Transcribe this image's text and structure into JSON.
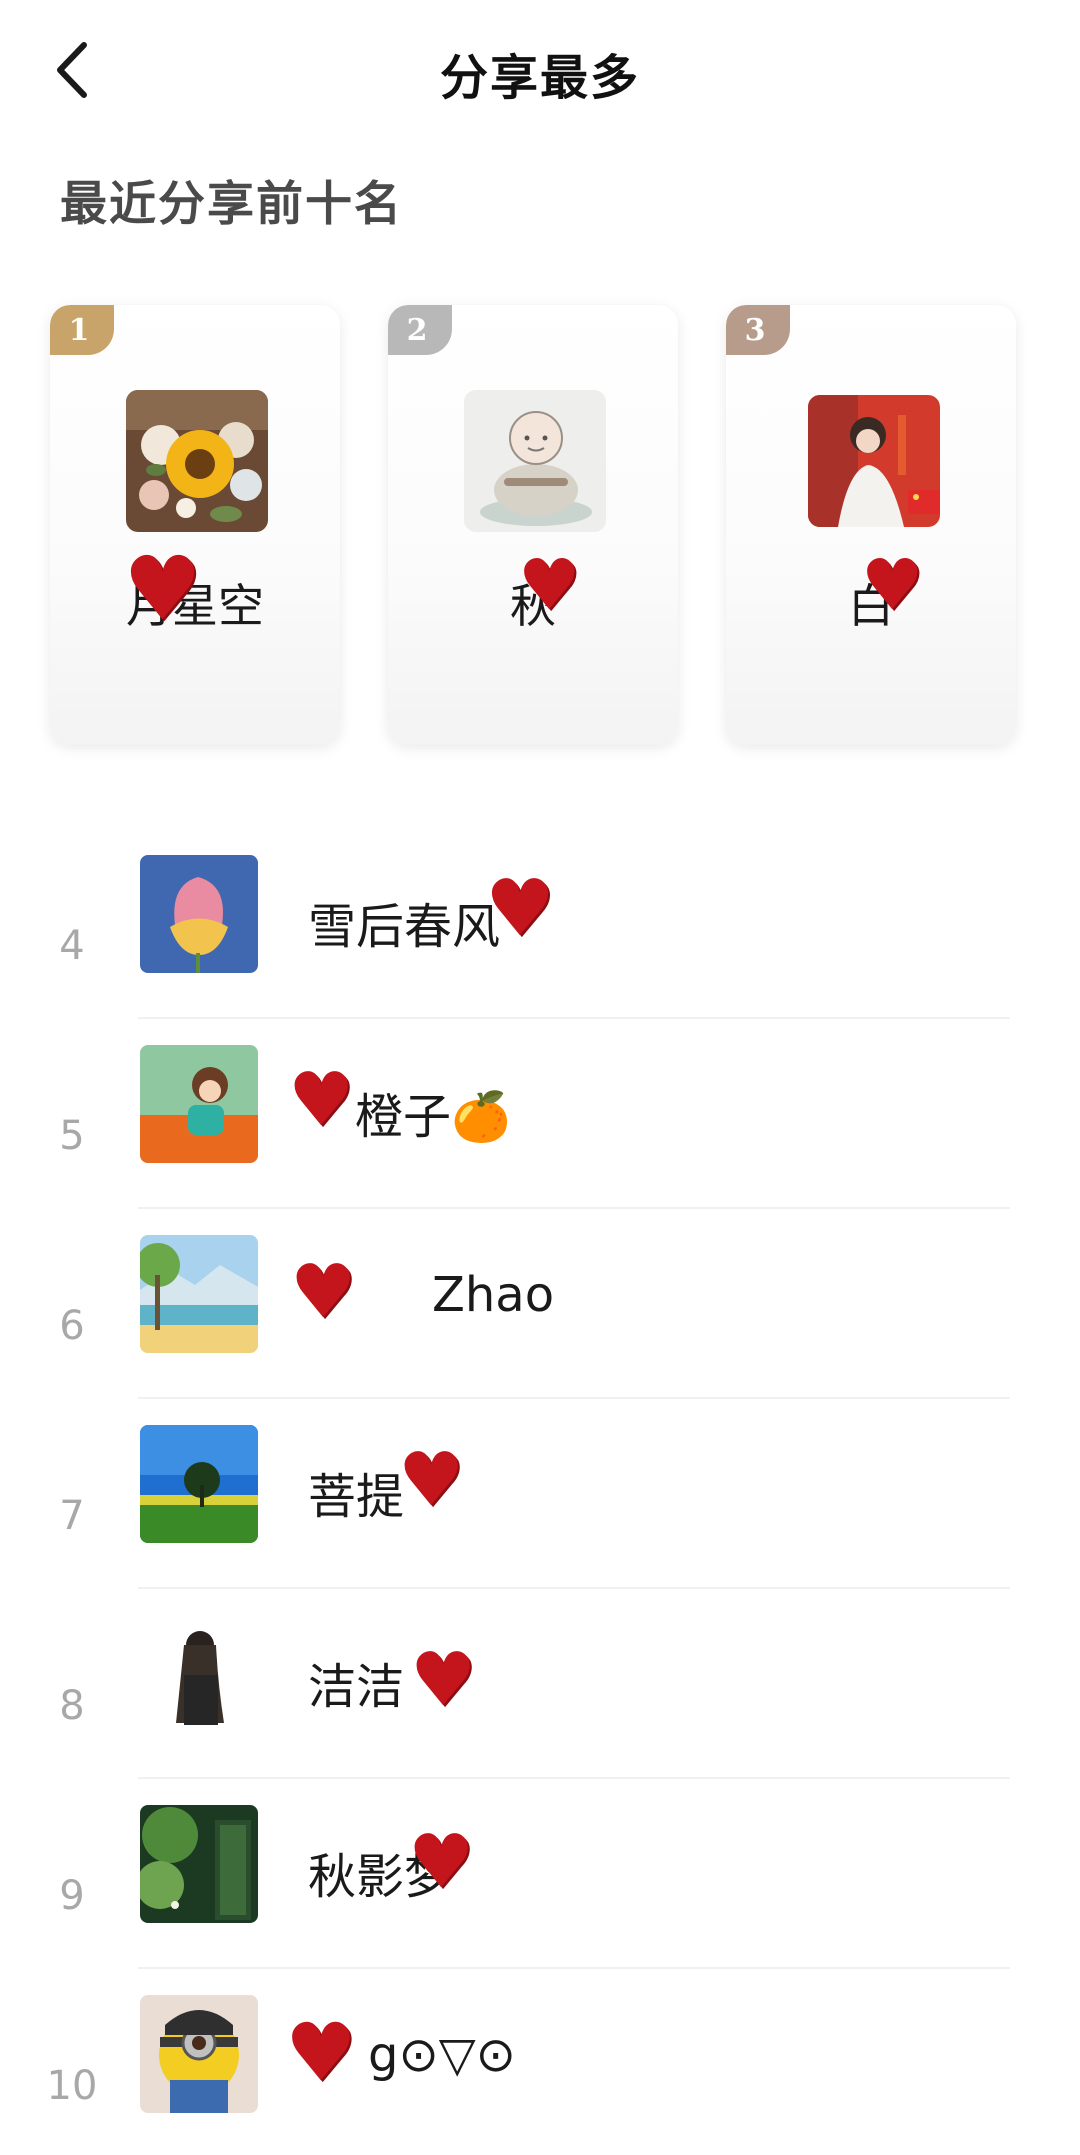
{
  "header": {
    "title": "分享最多"
  },
  "section_title": "最近分享前十名",
  "colors": {
    "gold": "#c9a46a",
    "silver": "#b8b8b8",
    "bronze": "#b79c8b",
    "redaction": "#c4141c"
  },
  "icons": {
    "back": "chevron-left-icon",
    "redaction": "heart-scribble-icon"
  },
  "top3": [
    {
      "rank": "1",
      "name": "月星空",
      "avatar": "sunflower-bouquet"
    },
    {
      "rank": "2",
      "name": "秋",
      "avatar": "meditating-monk"
    },
    {
      "rank": "3",
      "name": "白",
      "avatar": "festival-girl"
    }
  ],
  "list": [
    {
      "rank": "4",
      "name": "雪后春风",
      "avatar": "lotus-flower"
    },
    {
      "rank": "5",
      "name": "橙子🍊",
      "avatar": "cartoon-girl-car"
    },
    {
      "rank": "6",
      "name": "Zhao",
      "avatar": "lake-landscape"
    },
    {
      "rank": "7",
      "name": "菩提",
      "avatar": "lone-tree-field"
    },
    {
      "rank": "8",
      "name": "洁洁",
      "avatar": "girl-back-view"
    },
    {
      "rank": "9",
      "name": "秋影梦",
      "avatar": "green-garden-door"
    },
    {
      "rank": "10",
      "name": "g⊙▽⊙",
      "avatar": "minion"
    }
  ]
}
